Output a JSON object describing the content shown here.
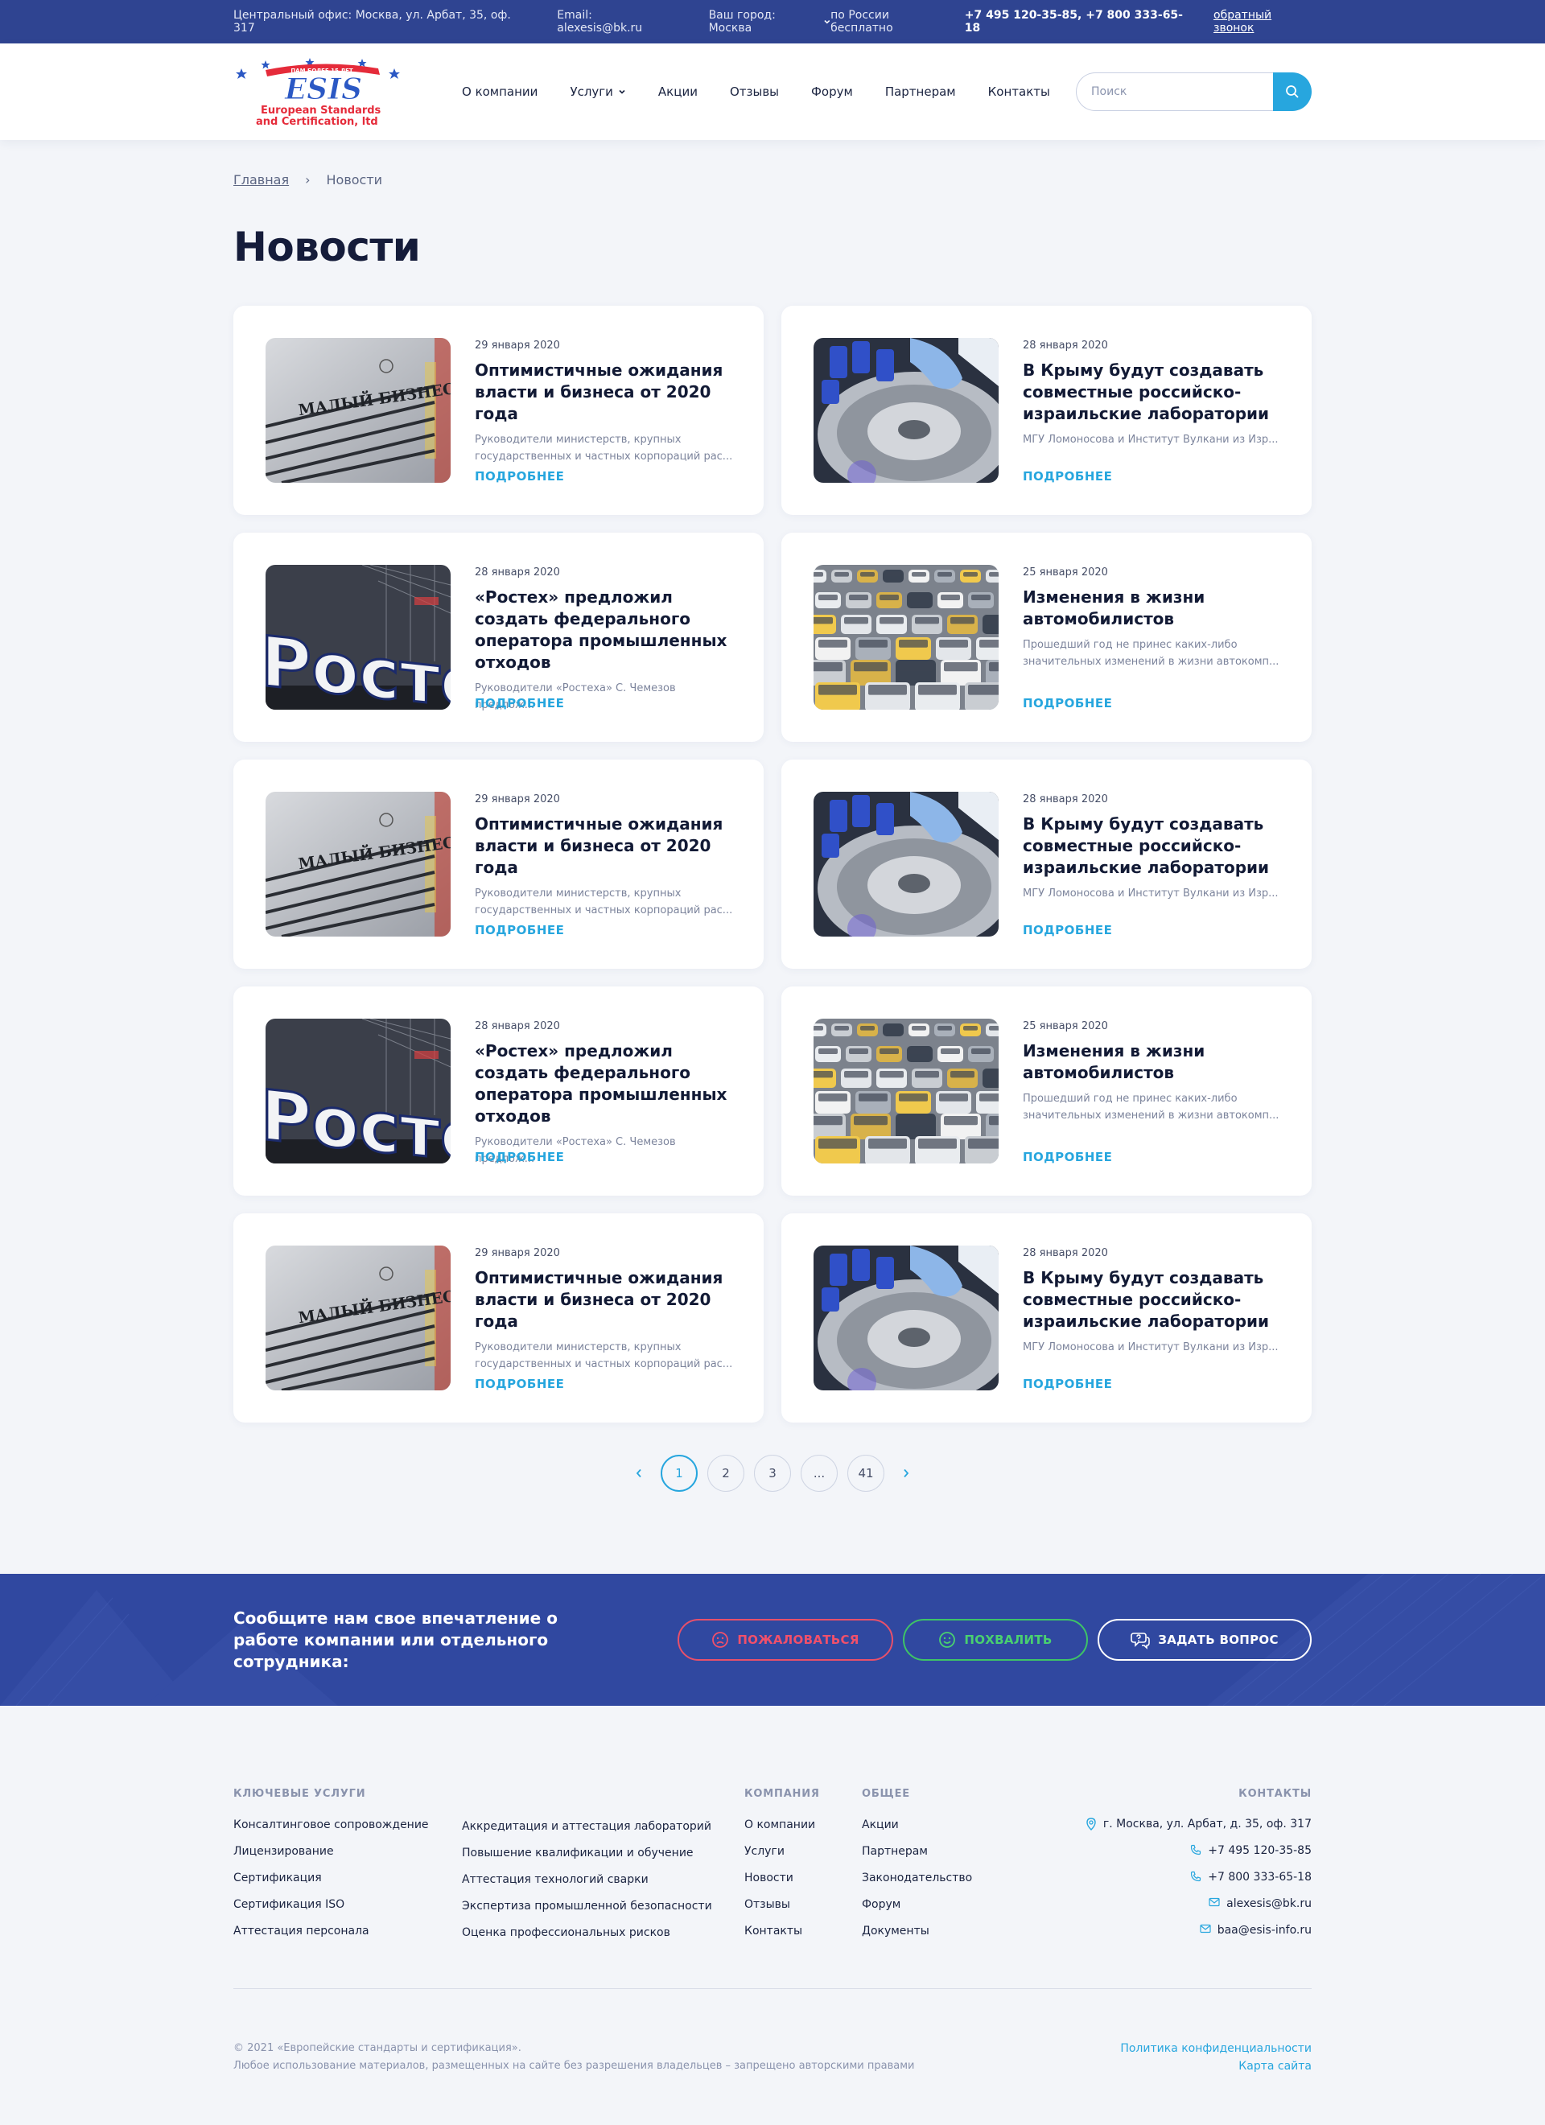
{
  "topbar": {
    "office": "Центральный офис: Москва, ул. Арбат, 35, оф. 317",
    "email": "Email: alexesis@bk.ru",
    "city": "Ваш город: Москва",
    "free_label": "по России бесплатно",
    "phones": "+7 495 120-35-85, +7 800 333-65-18",
    "callback": "обратный звонок"
  },
  "logo": {
    "banner": "ПАМ БОЛЕЕ 15 ЛЕТ",
    "mark": "ESIS",
    "line1": "European Standards",
    "line2": "and Certification, ltd"
  },
  "nav": {
    "items": [
      "О компании",
      "Услуги",
      "Акции",
      "Отзывы",
      "Форум",
      "Партнерам",
      "Контакты"
    ]
  },
  "search": {
    "placeholder": "Поиск"
  },
  "breadcrumb": {
    "home": "Главная",
    "sep": "›",
    "current": "Новости"
  },
  "page_title": "Новости",
  "news": [
    {
      "date": "29 января 2020",
      "title": "Оптимистичные ожидания власти и бизнеса от 2020 года",
      "excerpt": "Руководители министерств, крупных государственных и частных корпораций рас...",
      "more": "ПОДРОБНЕЕ",
      "image": "small-business-stand",
      "thumb_text": "МАЛЫЙ БИЗНЕС"
    },
    {
      "date": "28 января 2020",
      "title": "В Крыму будут создавать совместные российско-израильские лаборатории",
      "excerpt": "МГУ Ломоносова и Институт Вулкани из Изр...",
      "more": "ПОДРОБНЕЕ",
      "image": "lab-centrifuge"
    },
    {
      "date": "28 января 2020",
      "title": "«Ростех» предложил создать федерального оператора промышленных отходов",
      "excerpt": "Руководители «Ростеха» С. Чемезов предлож...",
      "more": "ПОДРОБНЕЕ",
      "image": "rostec-sign",
      "thumb_text": "Ростех"
    },
    {
      "date": "25 января 2020",
      "title": "Изменения в жизни автомобилистов",
      "excerpt": "Прошедший год не принес каких-либо значительных изменений в жизни автокомп...",
      "more": "ПОДРОБНЕЕ",
      "image": "traffic-jam"
    },
    {
      "date": "29 января 2020",
      "title": "Оптимистичные ожидания власти и бизнеса от 2020 года",
      "excerpt": "Руководители министерств, крупных государственных и частных корпораций рас...",
      "more": "ПОДРОБНЕЕ",
      "image": "small-business-stand",
      "thumb_text": "МАЛЫЙ БИЗНЕС"
    },
    {
      "date": "28 января 2020",
      "title": "В Крыму будут создавать совместные российско-израильские лаборатории",
      "excerpt": "МГУ Ломоносова и Институт Вулкани из Изр...",
      "more": "ПОДРОБНЕЕ",
      "image": "lab-centrifuge"
    },
    {
      "date": "28 января 2020",
      "title": "«Ростех» предложил создать федерального оператора промышленных отходов",
      "excerpt": "Руководители «Ростеха» С. Чемезов предлож...",
      "more": "ПОДРОБНЕЕ",
      "image": "rostec-sign",
      "thumb_text": "Ростех"
    },
    {
      "date": "25 января 2020",
      "title": "Изменения в жизни автомобилистов",
      "excerpt": "Прошедший год не принес каких-либо значительных изменений в жизни автокомп...",
      "more": "ПОДРОБНЕЕ",
      "image": "traffic-jam"
    },
    {
      "date": "29 января 2020",
      "title": "Оптимистичные ожидания власти и бизнеса от 2020 года",
      "excerpt": "Руководители министерств, крупных государственных и частных корпораций рас...",
      "more": "ПОДРОБНЕЕ",
      "image": "small-business-stand",
      "thumb_text": "МАЛЫЙ БИЗНЕС"
    },
    {
      "date": "28 января 2020",
      "title": "В Крыму будут создавать совместные российско-израильские лаборатории",
      "excerpt": "МГУ Ломоносова и Институт Вулкани из Изр...",
      "more": "ПОДРОБНЕЕ",
      "image": "lab-centrifuge"
    }
  ],
  "pagination": {
    "prev": "‹",
    "pages": [
      "1",
      "2",
      "3",
      "...",
      "41"
    ],
    "current": "1",
    "next": "›"
  },
  "feedback": {
    "text": "Сообщите нам свое впечатление о работе компании или отдельного сотрудника:",
    "complain": "ПОЖАЛОВАТЬСЯ",
    "praise": "ПОХВАЛИТЬ",
    "ask": "ЗАДАТЬ ВОПРОС"
  },
  "footer": {
    "services_head": "КЛЮЧЕВЫЕ УСЛУГИ",
    "services_col1": [
      "Консалтинговое сопровождение",
      "Лицензирование",
      "Сертификация",
      "Сертификация ISO",
      "Аттестация персонала"
    ],
    "services_col2": [
      "Аккредитация и аттестация лабораторий",
      "Повышение квалификации и обучение",
      "Аттестация технологий сварки",
      "Экспертиза промышленной безопасности",
      "Оценка профессиональных рисков"
    ],
    "company_head": "КОМПАНИЯ",
    "company": [
      "О компании",
      "Услуги",
      "Новости",
      "Отзывы",
      "Контакты"
    ],
    "general_head": "ОБЩЕЕ",
    "general": [
      "Акции",
      "Партнерам",
      "Законодательство",
      "Форум",
      "Документы"
    ],
    "contacts_head": "КОНТАКТЫ",
    "contacts": [
      {
        "icon": "location-icon",
        "text": "г. Москва, ул. Арбат, д. 35, оф. 317"
      },
      {
        "icon": "phone-icon",
        "text": "+7 495 120-35-85"
      },
      {
        "icon": "phone-icon",
        "text": "+7 800 333-65-18"
      },
      {
        "icon": "mail-icon",
        "text": "alexesis@bk.ru"
      },
      {
        "icon": "mail-icon",
        "text": "baa@esis-info.ru"
      }
    ],
    "copyright": "© 2021 «Европейские стандарты и сертификация».",
    "rights": "Любое использование материалов, размещенных на сайте без разрешения владельцев – запрещено авторскими правами",
    "privacy": "Политика конфиденциальности",
    "sitemap": "Карта сайта"
  },
  "colors": {
    "topbar": "#2f4491",
    "accent": "#27a6de",
    "feedback_band": "#3048a0",
    "complain": "#e8506a",
    "praise": "#3ec466"
  }
}
